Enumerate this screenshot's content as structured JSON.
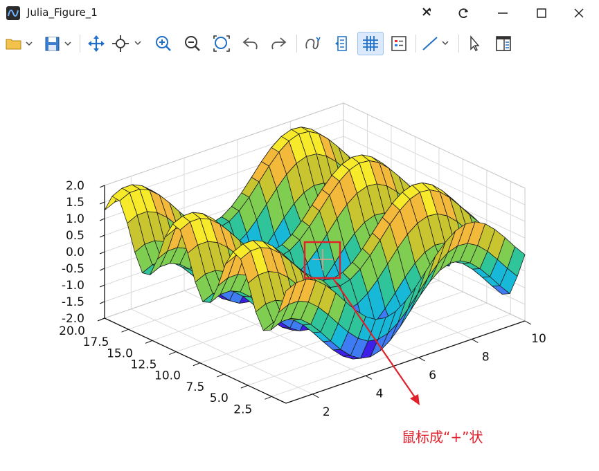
{
  "window": {
    "title": "Julia_Figure_1",
    "buttons": [
      "pin-icon",
      "refresh-icon",
      "minimize-icon",
      "maximize-icon",
      "close-icon"
    ]
  },
  "toolbar": {
    "items": [
      "open-folder-icon",
      "save-icon",
      "pan-icon",
      "zoom-cursor-icon",
      "zoom-in-icon",
      "zoom-out-icon",
      "zoom-fit-icon",
      "undo-icon",
      "redo-icon",
      "rotate-icon",
      "data-cursor-icon",
      "grid-icon",
      "legend-icon",
      "line-style-icon",
      "select-icon",
      "panel-icon"
    ],
    "active_item": "grid-icon"
  },
  "chart_data": {
    "type": "surface",
    "title": "",
    "x_ticks": [
      "2",
      "4",
      "6",
      "8",
      "10"
    ],
    "y_ticks": [
      "2.5",
      "5.0",
      "7.5",
      "10.0",
      "12.5",
      "15.0",
      "17.5",
      "20.0"
    ],
    "z_ticks": [
      "-2.0",
      "-1.5",
      "-1.0",
      "-0.5",
      "0.0",
      "0.5",
      "1.0",
      "1.5",
      "2.0"
    ],
    "x_range": [
      1,
      10
    ],
    "y_range": [
      1,
      20
    ],
    "z_range": [
      -2.0,
      2.0
    ],
    "grid": true,
    "colormap": [
      "#3d1fe8",
      "#3f7cf4",
      "#17b8d8",
      "#2fc49a",
      "#7fce52",
      "#c8c530",
      "#f3b93a",
      "#f7ea2a"
    ]
  },
  "annotation": {
    "text": "鼠标成“+”状",
    "color": "#e0202a"
  }
}
